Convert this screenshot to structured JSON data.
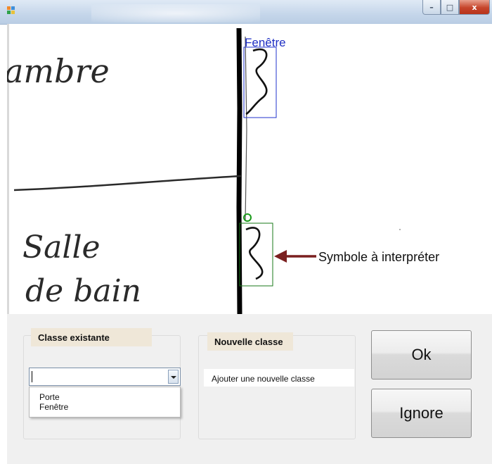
{
  "window": {
    "title": "",
    "controls": {
      "minimize": "–",
      "maximize": "□",
      "close": "x"
    }
  },
  "canvas": {
    "handwriting": [
      "ambre",
      "Salle",
      "de bain"
    ],
    "detection_label": "Fenêtre",
    "annotation": "Symbole à interpréter",
    "colors": {
      "detected_box": "#2233cc",
      "candidate_box": "#1a7a1a",
      "arrow": "#7a1f1f"
    }
  },
  "existing_class": {
    "title": "Classe existante",
    "value": "",
    "options": [
      "Porte",
      "Fenêtre"
    ]
  },
  "new_class": {
    "title": "Nouvelle classe",
    "placeholder": "Ajouter une nouvelle classe"
  },
  "buttons": {
    "ok": "Ok",
    "ignore": "Ignore"
  }
}
